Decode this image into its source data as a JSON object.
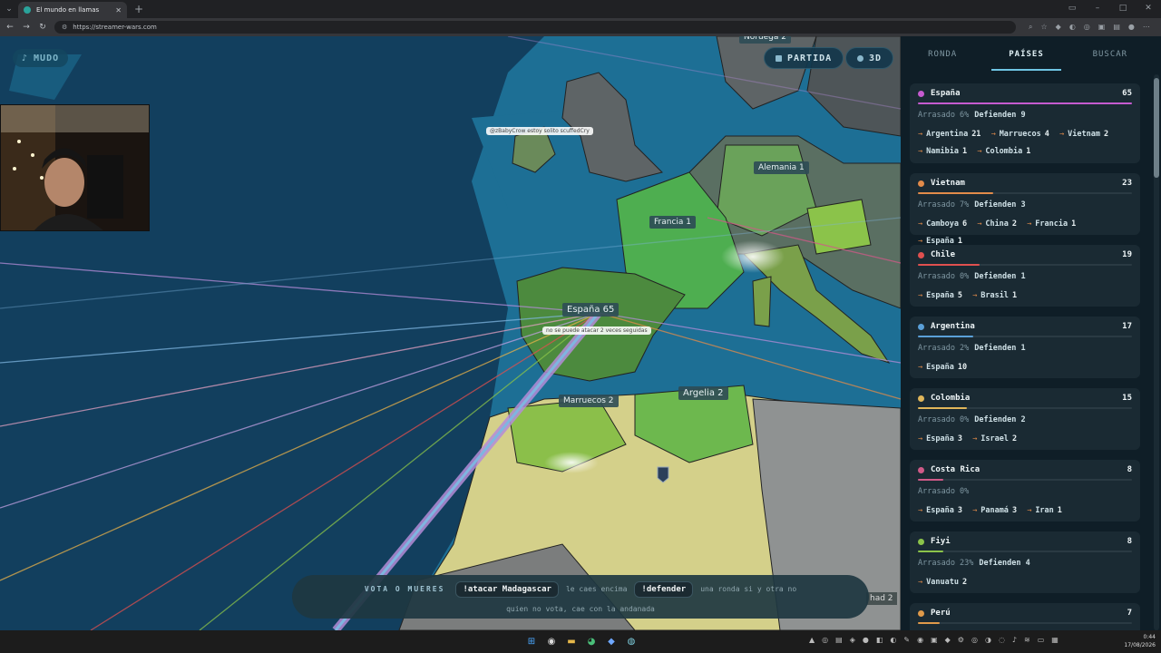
{
  "browser": {
    "tab_title": "El mundo en llamas",
    "tab_close": "✕",
    "new_tab": "+",
    "url": "https://streamer-wars.com",
    "window_controls": [
      "▭",
      "–",
      "□",
      "✕"
    ]
  },
  "overlay": {
    "mute_label": "MUDO",
    "partida_label": "PARTIDA",
    "view_3d_label": "3D"
  },
  "map": {
    "labels": {
      "noruega": "Noruega 2",
      "alemania": "Alemania 1",
      "francia": "Francia 1",
      "espana": "España 65",
      "marruecos": "Marruecos 2",
      "argelia": "Argelia 2",
      "chad": "had 2"
    },
    "chat_messages": {
      "msg1": "@zBabyCrow estoy solito scuffedCry",
      "msg2": "no se puede atacar 2 veces seguidas"
    }
  },
  "vote_bar": {
    "title": "VOTA O MUERES",
    "attack_cmd": "!atacar Madagascar",
    "attack_desc": "le caes encima",
    "defend_cmd": "!defender",
    "defend_desc": "una ronda si y otra no",
    "footer": "quien no vota, cae con la andanada"
  },
  "panel": {
    "tabs": [
      "RONDA",
      "PAÍSES",
      "BUSCAR"
    ],
    "active_tab": "PAÍSES",
    "arrow": "→",
    "countries": [
      {
        "name": "España",
        "score": "65",
        "color": "#c65bd0",
        "bar": 1.0,
        "arrasado": "Arrasado 6%",
        "defienden": "Defienden 9",
        "attacks": [
          [
            "Argentina",
            "21"
          ],
          [
            "Marruecos",
            "4"
          ],
          [
            "Vietnam",
            "2"
          ],
          [
            "Namibia",
            "1"
          ],
          [
            "Colombia",
            "1"
          ]
        ]
      },
      {
        "name": "Vietnam",
        "score": "23",
        "color": "#e28b4a",
        "bar": 0.35,
        "arrasado": "Arrasado 7%",
        "defienden": "Defienden 3",
        "attacks": [
          [
            "Camboya",
            "6"
          ],
          [
            "China",
            "2"
          ],
          [
            "Francia",
            "1"
          ],
          [
            "España",
            "1"
          ]
        ]
      },
      {
        "name": "Chile",
        "score": "19",
        "color": "#e0504f",
        "bar": 0.29,
        "arrasado": "Arrasado 0%",
        "defienden": "Defienden 1",
        "attacks": [
          [
            "España",
            "5"
          ],
          [
            "Brasil",
            "1"
          ]
        ]
      },
      {
        "name": "Argentina",
        "score": "17",
        "color": "#5aa0d8",
        "bar": 0.26,
        "arrasado": "Arrasado 2%",
        "defienden": "Defienden 1",
        "attacks": [
          [
            "España",
            "10"
          ]
        ]
      },
      {
        "name": "Colombia",
        "score": "15",
        "color": "#e0b65a",
        "bar": 0.23,
        "arrasado": "Arrasado 0%",
        "defienden": "Defienden 2",
        "attacks": [
          [
            "España",
            "3"
          ],
          [
            "Israel",
            "2"
          ]
        ]
      },
      {
        "name": "Costa Rica",
        "score": "8",
        "color": "#d05a88",
        "bar": 0.12,
        "arrasado": "Arrasado 0%",
        "defienden": "",
        "attacks": [
          [
            "España",
            "3"
          ],
          [
            "Panamá",
            "3"
          ],
          [
            "Iran",
            "1"
          ]
        ]
      },
      {
        "name": "Fiyi",
        "score": "8",
        "color": "#8bc34a",
        "bar": 0.12,
        "arrasado": "Arrasado 23%",
        "defienden": "Defienden 4",
        "attacks": [
          [
            "Vanuatu",
            "2"
          ]
        ]
      },
      {
        "name": "Perú",
        "score": "7",
        "color": "#e09a4a",
        "bar": 0.1,
        "arrasado": "",
        "defienden": "",
        "attacks": []
      }
    ]
  },
  "taskbar": {
    "time": "0:44",
    "date": "17/08/2026"
  }
}
